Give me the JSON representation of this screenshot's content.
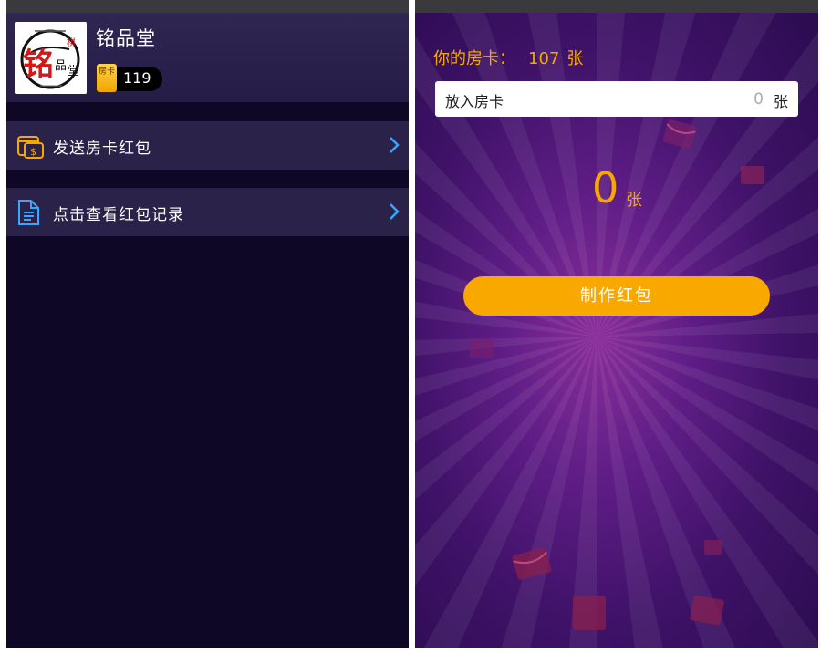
{
  "left_screen": {
    "profile": {
      "avatar_text": "铭品堂",
      "nickname": "铭品堂",
      "card_icon_text": "房卡",
      "card_count": "119"
    },
    "menu": [
      {
        "label": "发送房卡红包",
        "icon": "gift-envelope-icon"
      },
      {
        "label": "点击查看红包记录",
        "icon": "document-icon"
      }
    ]
  },
  "right_screen": {
    "my_cards_label": "你的房卡：",
    "my_cards_count": "107",
    "my_cards_unit": "张",
    "input": {
      "label": "放入房卡",
      "value": "0",
      "unit": "张"
    },
    "amount": "0",
    "amount_unit": "张",
    "make_button": "制作红包"
  },
  "colors": {
    "accent": "#f9a800",
    "left_bg": "#0f0726",
    "row_bg": "#2a2248",
    "chevron": "#38a6ff"
  }
}
